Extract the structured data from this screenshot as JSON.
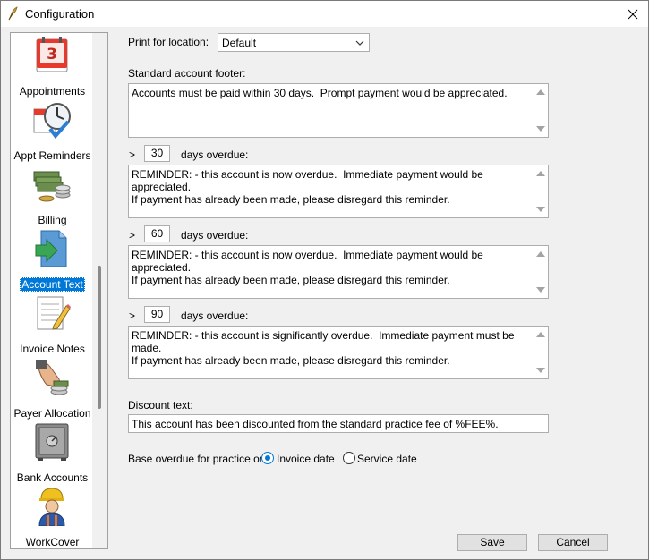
{
  "window": {
    "title": "Configuration"
  },
  "sidebar": {
    "items": [
      {
        "label": "Appointments"
      },
      {
        "label": "Appt Reminders"
      },
      {
        "label": "Billing"
      },
      {
        "label": "Account Text"
      },
      {
        "label": "Invoice Notes"
      },
      {
        "label": "Payer Allocation"
      },
      {
        "label": "Bank Accounts"
      },
      {
        "label": "WorkCover"
      }
    ],
    "selected": "Account Text",
    "calendar_day": "3"
  },
  "form": {
    "print_location_label": "Print for location:",
    "print_location_value": "Default",
    "footer_label": "Standard account footer:",
    "footer_text": "Accounts must be paid within 30 days.  Prompt payment would be appreciated.",
    "overdue": [
      {
        "prefix": ">",
        "days": "30",
        "suffix": "days overdue:",
        "text": "REMINDER: - this account is now overdue.  Immediate payment would be appreciated.\nIf payment has already been made, please disregard this reminder."
      },
      {
        "prefix": ">",
        "days": "60",
        "suffix": "days overdue:",
        "text": "REMINDER: - this account is now overdue.  Immediate payment would be appreciated.\nIf payment has already been made, please disregard this reminder."
      },
      {
        "prefix": ">",
        "days": "90",
        "suffix": "days overdue:",
        "text": "REMINDER: - this account is significantly overdue.  Immediate payment must be made.\nIf payment has already been made, please disregard this reminder."
      }
    ],
    "discount_label": "Discount text:",
    "discount_text": "This account has been discounted from the standard practice fee of %FEE%.",
    "base_overdue_label": "Base overdue for practice on:",
    "radio_invoice": "Invoice date",
    "radio_service": "Service date",
    "radio_selected": "Invoice date"
  },
  "buttons": {
    "save": "Save",
    "cancel": "Cancel"
  },
  "colors": {
    "accent": "#0078d7",
    "window_bg": "#f0f0f0",
    "selection": "#0078d7"
  },
  "icons": [
    "app-feather-icon",
    "close-icon",
    "calendar-icon",
    "clock-check-icon",
    "money-icon",
    "document-arrow-icon",
    "notepad-pencil-icon",
    "hand-coins-icon",
    "safe-icon",
    "worker-icon",
    "chevron-down-icon"
  ]
}
